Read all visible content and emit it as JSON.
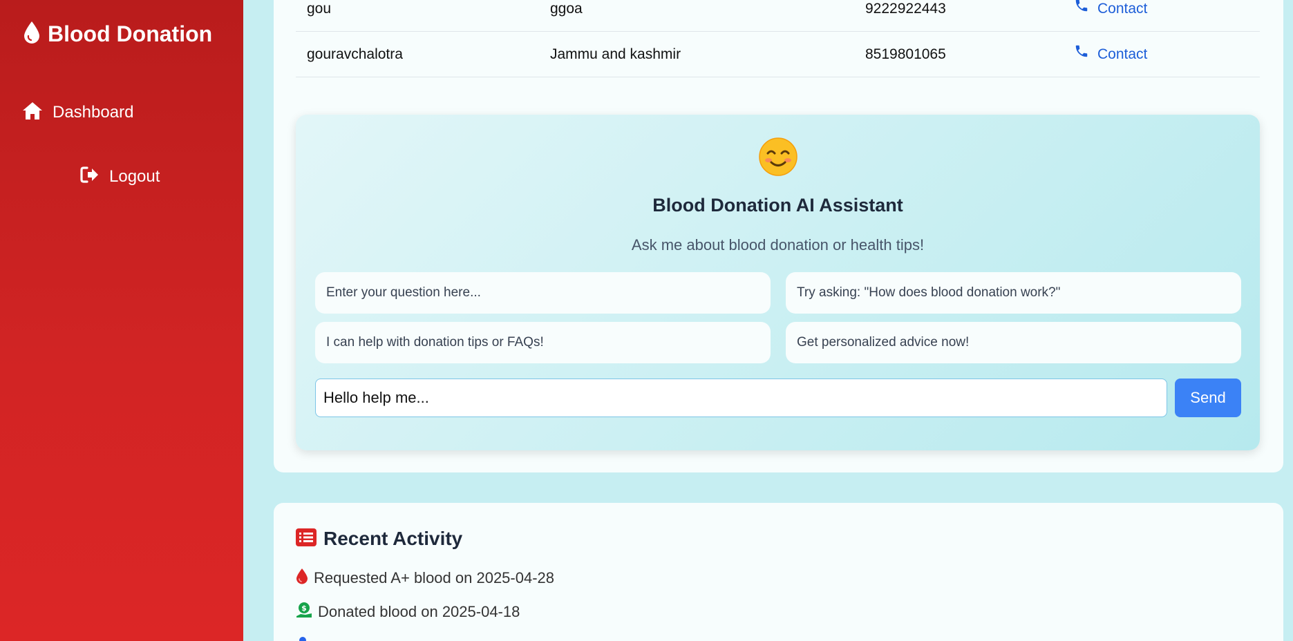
{
  "sidebar": {
    "brand": "Blood Donation",
    "brand_icon": "blood-drop-icon",
    "items": [
      {
        "label": "Dashboard",
        "icon": "home-icon"
      },
      {
        "label": "Logout",
        "icon": "logout-icon"
      }
    ],
    "colors": {
      "background_top": "#b91c1c",
      "background_bottom": "#dc2626"
    }
  },
  "donors_table": {
    "rows": [
      {
        "name": "gou",
        "location": "ggoa",
        "phone": "9222922443",
        "action": "Contact"
      },
      {
        "name": "gouravchalotra",
        "location": "Jammu and kashmir",
        "phone": "8519801065",
        "action": "Contact"
      }
    ]
  },
  "assistant": {
    "emoji": "😊",
    "title": "Blood Donation AI Assistant",
    "subtitle": "Ask me about blood donation or health tips!",
    "suggestions": [
      "Enter your question here...",
      "Try asking: \"How does blood donation work?\"",
      "I can help with donation tips or FAQs!",
      "Get personalized advice now!"
    ],
    "input_value": "Hello help me...",
    "send_label": "Send",
    "colors": {
      "send_button": "#3b82f6"
    }
  },
  "recent_activity": {
    "title": "Recent Activity",
    "title_icon": "list-icon",
    "items": [
      {
        "text": "Requested A+ blood on 2025-04-28",
        "icon": "blood-drop-icon"
      },
      {
        "text": "Donated blood on 2025-04-18",
        "icon": "donate-hand-icon"
      }
    ]
  }
}
